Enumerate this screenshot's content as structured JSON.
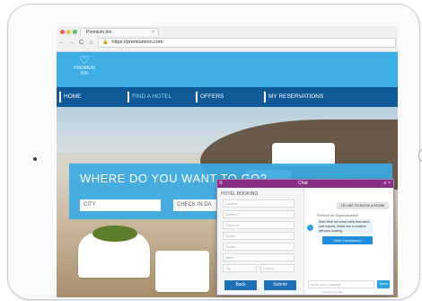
{
  "browser": {
    "tab_title": "Premium Inn",
    "tab_close": "×",
    "back": "←",
    "forward": "→",
    "reload": "C",
    "home": "⌂",
    "lock": "🔒",
    "url": "https://premiuminn.com",
    "traffic_light_colors": [
      "#ee5a52",
      "#f5bd4f",
      "#5fc454"
    ]
  },
  "site": {
    "logo_mark": "♡",
    "logo_line1": "PREMIUM",
    "logo_line2": "INN",
    "brand_color": "#3daee4",
    "nav_color": "#0f5a97",
    "nav": [
      {
        "label": "HOME"
      },
      {
        "label": "FIND A HOTEL"
      },
      {
        "label": "OFFERS"
      },
      {
        "label": "MY RESERVATIONS"
      }
    ]
  },
  "hero": {
    "search_title": "WHERE DO YOU WANT TO GO?",
    "city_placeholder": "CITY",
    "checkin_placeholder": "CHECK IN DA"
  },
  "chat": {
    "window_title": "Chat",
    "menu_icon": "≡",
    "controls": "∨ ×",
    "header_color": "#8b2f86",
    "booking": {
      "title": "HOTEL BOOKING",
      "fields": [
        "Location",
        "Check-in",
        "Check-out",
        "Rooms",
        "Guests",
        "Name",
        "Email"
      ],
      "half_fields": [
        "City",
        "Country"
      ],
      "back_label": "Back",
      "submit_label": "Submit"
    },
    "user_message": "I'D LIKE TO BOOK A ROOM",
    "agent_label": "Premium Inn Digital Assistant",
    "agent_message": "Sure! Here are some hotels that match your request. Select one to continue with your booking.",
    "view_button": "View Comparison",
    "input_placeholder": "Write your message",
    "send_label": "Send",
    "footer": "powered by chat"
  }
}
